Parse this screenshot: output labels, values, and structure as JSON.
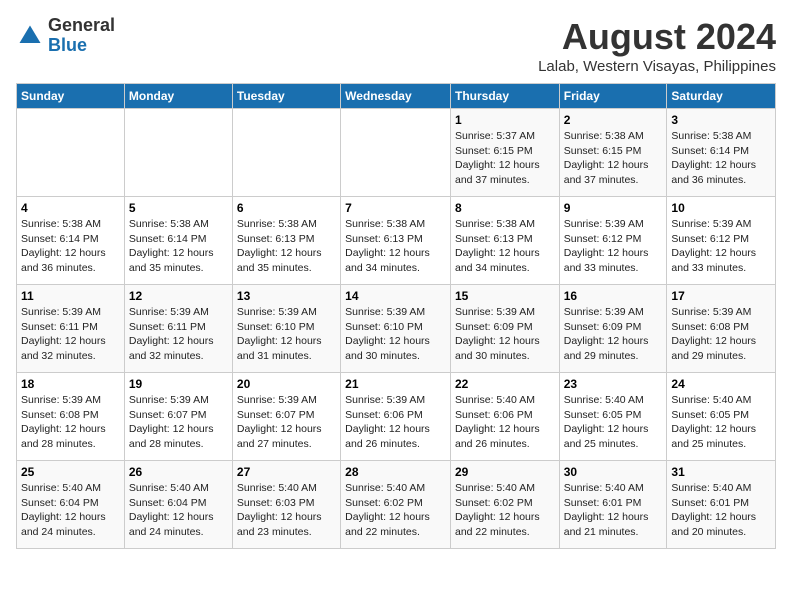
{
  "header": {
    "logo_general": "General",
    "logo_blue": "Blue",
    "title": "August 2024",
    "subtitle": "Lalab, Western Visayas, Philippines"
  },
  "weekdays": [
    "Sunday",
    "Monday",
    "Tuesday",
    "Wednesday",
    "Thursday",
    "Friday",
    "Saturday"
  ],
  "weeks": [
    [
      {
        "day": "",
        "info": ""
      },
      {
        "day": "",
        "info": ""
      },
      {
        "day": "",
        "info": ""
      },
      {
        "day": "",
        "info": ""
      },
      {
        "day": "1",
        "info": "Sunrise: 5:37 AM\nSunset: 6:15 PM\nDaylight: 12 hours\nand 37 minutes."
      },
      {
        "day": "2",
        "info": "Sunrise: 5:38 AM\nSunset: 6:15 PM\nDaylight: 12 hours\nand 37 minutes."
      },
      {
        "day": "3",
        "info": "Sunrise: 5:38 AM\nSunset: 6:14 PM\nDaylight: 12 hours\nand 36 minutes."
      }
    ],
    [
      {
        "day": "4",
        "info": "Sunrise: 5:38 AM\nSunset: 6:14 PM\nDaylight: 12 hours\nand 36 minutes."
      },
      {
        "day": "5",
        "info": "Sunrise: 5:38 AM\nSunset: 6:14 PM\nDaylight: 12 hours\nand 35 minutes."
      },
      {
        "day": "6",
        "info": "Sunrise: 5:38 AM\nSunset: 6:13 PM\nDaylight: 12 hours\nand 35 minutes."
      },
      {
        "day": "7",
        "info": "Sunrise: 5:38 AM\nSunset: 6:13 PM\nDaylight: 12 hours\nand 34 minutes."
      },
      {
        "day": "8",
        "info": "Sunrise: 5:38 AM\nSunset: 6:13 PM\nDaylight: 12 hours\nand 34 minutes."
      },
      {
        "day": "9",
        "info": "Sunrise: 5:39 AM\nSunset: 6:12 PM\nDaylight: 12 hours\nand 33 minutes."
      },
      {
        "day": "10",
        "info": "Sunrise: 5:39 AM\nSunset: 6:12 PM\nDaylight: 12 hours\nand 33 minutes."
      }
    ],
    [
      {
        "day": "11",
        "info": "Sunrise: 5:39 AM\nSunset: 6:11 PM\nDaylight: 12 hours\nand 32 minutes."
      },
      {
        "day": "12",
        "info": "Sunrise: 5:39 AM\nSunset: 6:11 PM\nDaylight: 12 hours\nand 32 minutes."
      },
      {
        "day": "13",
        "info": "Sunrise: 5:39 AM\nSunset: 6:10 PM\nDaylight: 12 hours\nand 31 minutes."
      },
      {
        "day": "14",
        "info": "Sunrise: 5:39 AM\nSunset: 6:10 PM\nDaylight: 12 hours\nand 30 minutes."
      },
      {
        "day": "15",
        "info": "Sunrise: 5:39 AM\nSunset: 6:09 PM\nDaylight: 12 hours\nand 30 minutes."
      },
      {
        "day": "16",
        "info": "Sunrise: 5:39 AM\nSunset: 6:09 PM\nDaylight: 12 hours\nand 29 minutes."
      },
      {
        "day": "17",
        "info": "Sunrise: 5:39 AM\nSunset: 6:08 PM\nDaylight: 12 hours\nand 29 minutes."
      }
    ],
    [
      {
        "day": "18",
        "info": "Sunrise: 5:39 AM\nSunset: 6:08 PM\nDaylight: 12 hours\nand 28 minutes."
      },
      {
        "day": "19",
        "info": "Sunrise: 5:39 AM\nSunset: 6:07 PM\nDaylight: 12 hours\nand 28 minutes."
      },
      {
        "day": "20",
        "info": "Sunrise: 5:39 AM\nSunset: 6:07 PM\nDaylight: 12 hours\nand 27 minutes."
      },
      {
        "day": "21",
        "info": "Sunrise: 5:39 AM\nSunset: 6:06 PM\nDaylight: 12 hours\nand 26 minutes."
      },
      {
        "day": "22",
        "info": "Sunrise: 5:40 AM\nSunset: 6:06 PM\nDaylight: 12 hours\nand 26 minutes."
      },
      {
        "day": "23",
        "info": "Sunrise: 5:40 AM\nSunset: 6:05 PM\nDaylight: 12 hours\nand 25 minutes."
      },
      {
        "day": "24",
        "info": "Sunrise: 5:40 AM\nSunset: 6:05 PM\nDaylight: 12 hours\nand 25 minutes."
      }
    ],
    [
      {
        "day": "25",
        "info": "Sunrise: 5:40 AM\nSunset: 6:04 PM\nDaylight: 12 hours\nand 24 minutes."
      },
      {
        "day": "26",
        "info": "Sunrise: 5:40 AM\nSunset: 6:04 PM\nDaylight: 12 hours\nand 24 minutes."
      },
      {
        "day": "27",
        "info": "Sunrise: 5:40 AM\nSunset: 6:03 PM\nDaylight: 12 hours\nand 23 minutes."
      },
      {
        "day": "28",
        "info": "Sunrise: 5:40 AM\nSunset: 6:02 PM\nDaylight: 12 hours\nand 22 minutes."
      },
      {
        "day": "29",
        "info": "Sunrise: 5:40 AM\nSunset: 6:02 PM\nDaylight: 12 hours\nand 22 minutes."
      },
      {
        "day": "30",
        "info": "Sunrise: 5:40 AM\nSunset: 6:01 PM\nDaylight: 12 hours\nand 21 minutes."
      },
      {
        "day": "31",
        "info": "Sunrise: 5:40 AM\nSunset: 6:01 PM\nDaylight: 12 hours\nand 20 minutes."
      }
    ]
  ]
}
